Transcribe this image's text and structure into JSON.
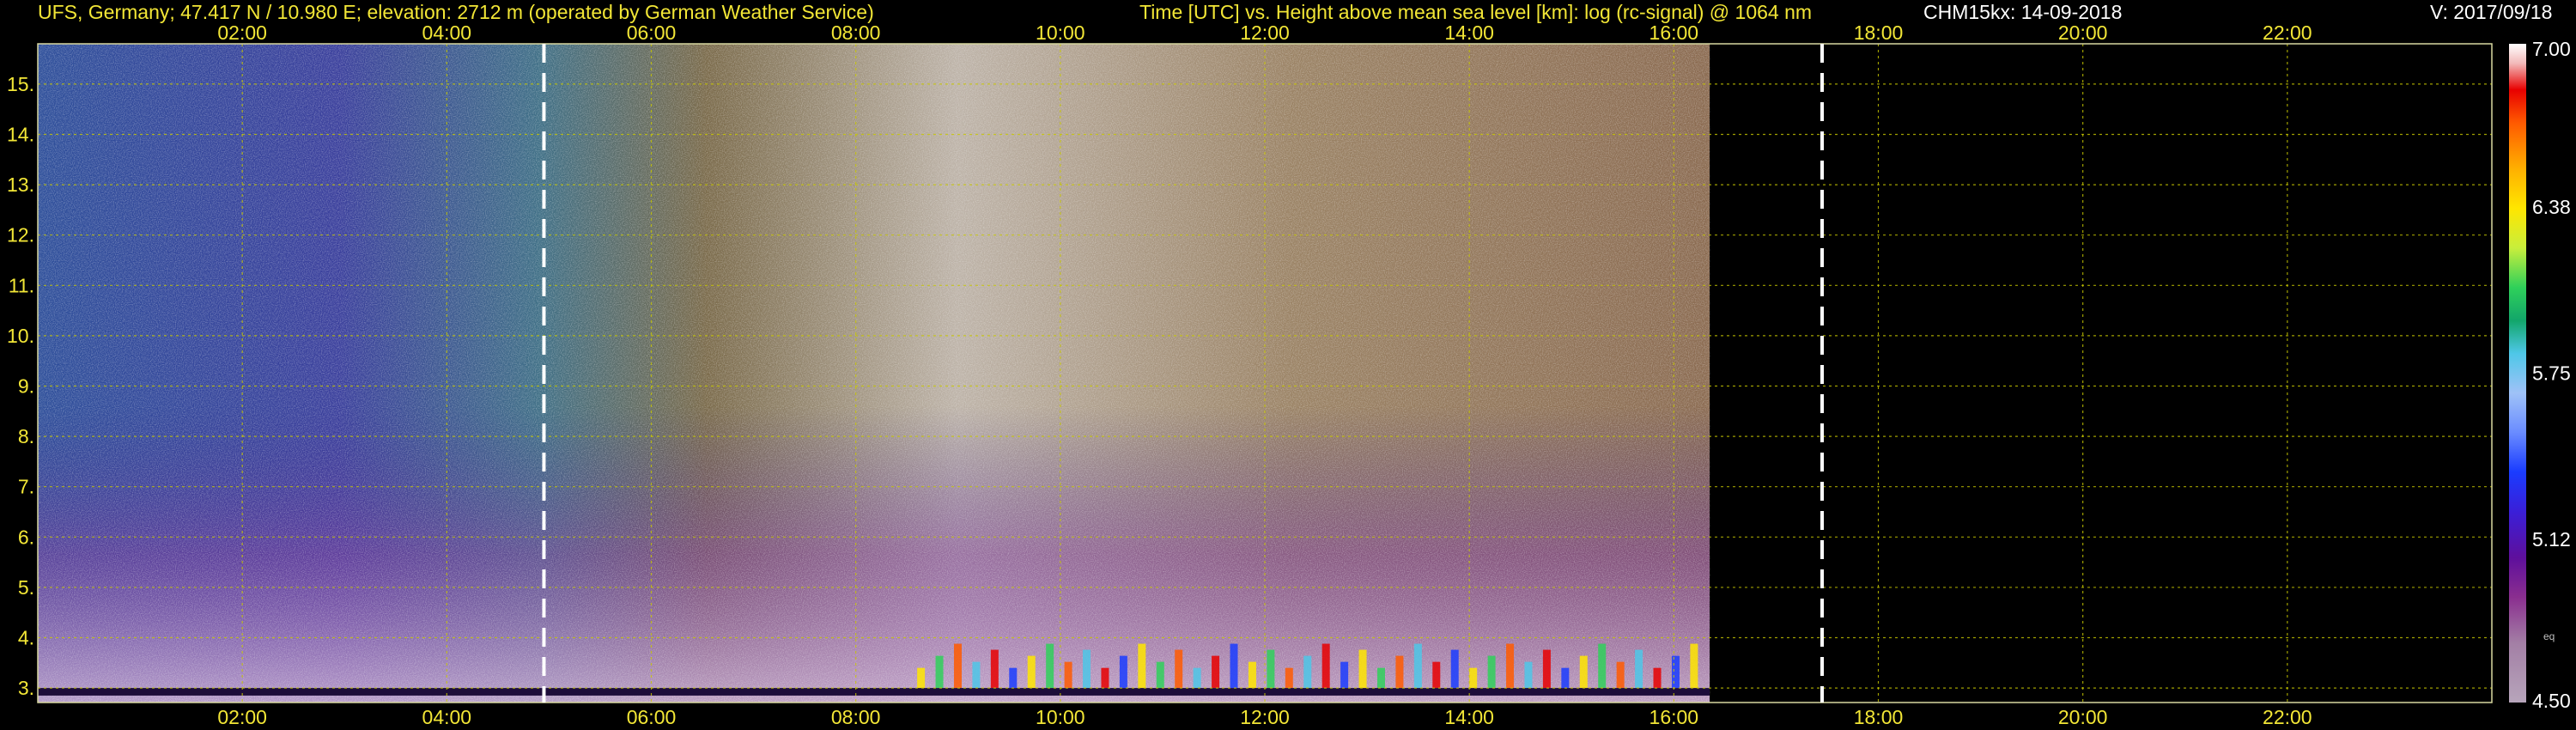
{
  "header": {
    "station": "UFS, Germany; 47.417 N / 10.980 E; elevation: 2712 m  (operated by German Weather Service)",
    "plot_description": "Time [UTC] vs. Height above mean sea level [km]: log (rc-signal) @ 1064 nm",
    "instrument_date": "CHM15kx: 14-09-2018",
    "version": "V: 2017/09/18"
  },
  "colors": {
    "header_text": "#f2e636",
    "grid": "#c8c800",
    "marker_line": "#ffffff",
    "background": "#000000"
  },
  "chart_data": {
    "type": "heatmap",
    "title": "Time [UTC] vs. Height above mean sea level [km]: log (rc-signal) @ 1064 nm",
    "x_ticks": [
      "02:00",
      "04:00",
      "06:00",
      "08:00",
      "10:00",
      "12:00",
      "14:00",
      "16:00",
      "18:00",
      "20:00",
      "22:00"
    ],
    "x_tick_hours": [
      2,
      4,
      6,
      8,
      10,
      12,
      14,
      16,
      18,
      20,
      22
    ],
    "xlim_hours": [
      0,
      24
    ],
    "y_ticks": [
      "3.",
      "4.",
      "5.",
      "6.",
      "7.",
      "8.",
      "9.",
      "10.",
      "11.",
      "12.",
      "13.",
      "14.",
      "15."
    ],
    "y_tick_km": [
      3,
      4,
      5,
      6,
      7,
      8,
      9,
      10,
      11,
      12,
      13,
      14,
      15
    ],
    "ylim_km": [
      2.712,
      15.8
    ],
    "data_end_hour": 16.35,
    "marker_lines_hours": [
      4.95,
      17.45
    ],
    "grid": true,
    "colorbar": {
      "ticks": [
        "7.00",
        "6.38",
        "5.75",
        "5.12",
        "4.50"
      ],
      "tick_values": [
        7.0,
        6.38,
        5.75,
        5.12,
        4.5
      ],
      "range": [
        4.5,
        7.0
      ],
      "small_label": "eq"
    }
  }
}
